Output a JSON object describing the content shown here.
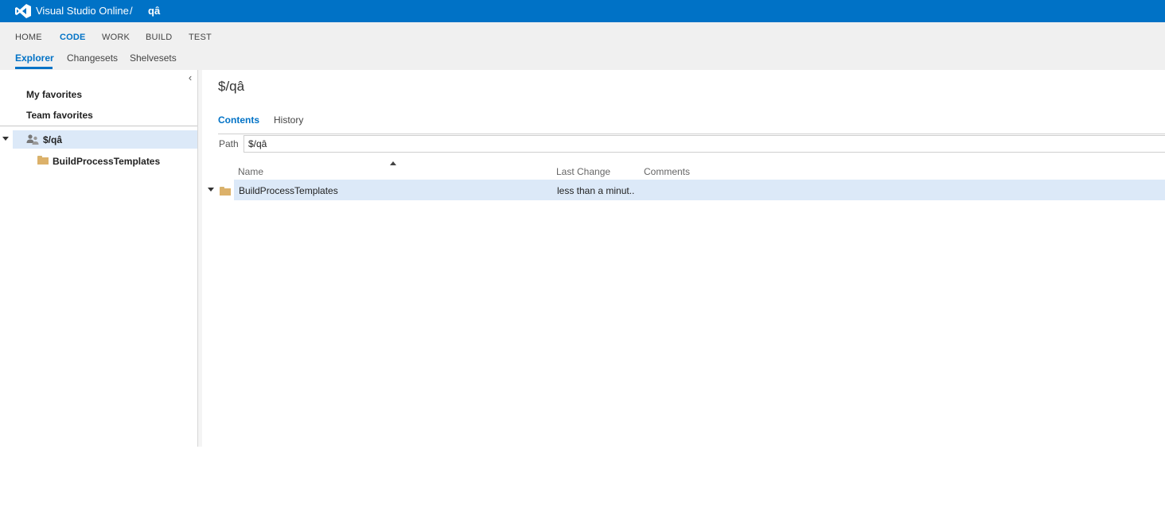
{
  "header": {
    "brand": "Visual Studio Online",
    "separator": "/",
    "project": "qâ",
    "brand_color": "#0072c6"
  },
  "hub_tabs": [
    {
      "label": "HOME",
      "active": false
    },
    {
      "label": "CODE",
      "active": true
    },
    {
      "label": "WORK",
      "active": false
    },
    {
      "label": "BUILD",
      "active": false
    },
    {
      "label": "TEST",
      "active": false
    }
  ],
  "sub_tabs": [
    {
      "label": "Explorer",
      "active": true
    },
    {
      "label": "Changesets",
      "active": false
    },
    {
      "label": "Shelvesets",
      "active": false
    }
  ],
  "left": {
    "collapse_icon": "‹",
    "my_favorites": "My favorites",
    "team_favorites": "Team favorites",
    "tree_root": "$/qâ",
    "tree_children": [
      "BuildProcessTemplates"
    ]
  },
  "main": {
    "title": "$/qâ",
    "tabs": [
      {
        "label": "Contents",
        "active": true
      },
      {
        "label": "History",
        "active": false
      }
    ],
    "path_label": "Path",
    "path_value": "$/qâ",
    "columns": [
      "Name",
      "Last Change",
      "Comments"
    ],
    "rows": [
      {
        "name": "BuildProcessTemplates",
        "last_change": "less than a minut..",
        "comments": ""
      }
    ]
  },
  "colors": {
    "accent": "#0072c6",
    "selection": "#dce9f8",
    "folder": "#dcb16a"
  }
}
